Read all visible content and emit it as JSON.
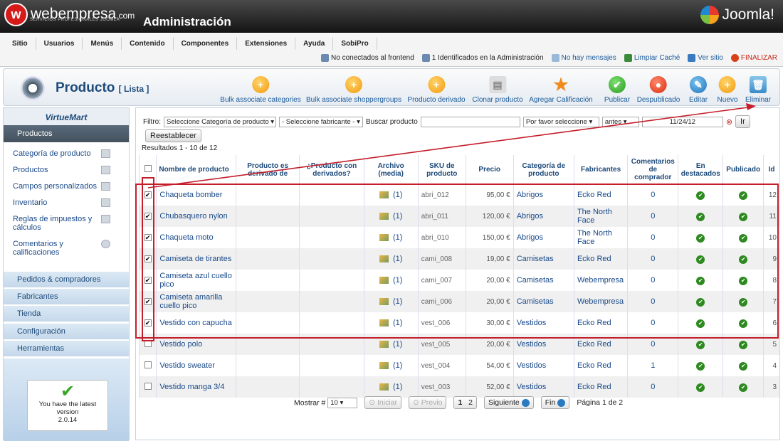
{
  "header": {
    "brand": "webempresa",
    "brand_suffix": ".com",
    "brand_tagline": "SERVICIOS PROFESIONALES JOOMLA",
    "title": "Administración",
    "joomla": "Joomla!"
  },
  "menu": [
    "Sitio",
    "Usuarios",
    "Menús",
    "Contenido",
    "Componentes",
    "Extensiones",
    "Ayuda",
    "SobiPro"
  ],
  "status": {
    "frontend": "No conectados al frontend",
    "admin": "1 Identificados en la Administración",
    "messages": "No hay mensajes",
    "cache": "Limpiar Caché",
    "site": "Ver sitio",
    "logout": "FINALIZAR"
  },
  "page": {
    "title": "Producto",
    "subtitle": "[ Lista ]"
  },
  "toolbar": [
    "Bulk associate categories",
    "Bulk associate shoppergroups",
    "Producto derivado",
    "Clonar producto",
    "Agregar Calificación",
    "Publicar",
    "Despublicado",
    "Editar",
    "Nuevo",
    "Eliminar"
  ],
  "sidebar": {
    "logo": "VirtueMart",
    "section": "Productos",
    "items": [
      "Categoría de producto",
      "Productos",
      "Campos personalizados",
      "Inventario",
      "Reglas de impuestos y cálculos",
      "Comentarios y calificaciones"
    ],
    "sections": [
      "Pedidos & compradores",
      "Fabricantes",
      "Tienda",
      "Configuración",
      "Herramientas"
    ],
    "latest": "You have the latest version",
    "version": "2.0.14"
  },
  "filter": {
    "label": "Filtro:",
    "category": "Seleccione Categoría de producto",
    "manufacturer": "- Seleccione fabricante -",
    "search_label": "Buscar producto",
    "order": "Por favor seleccione",
    "when": "antes",
    "date": "11/24/12",
    "go": "Ir",
    "reset": "Reestablecer",
    "results": "Resultados 1 - 10 de 12"
  },
  "columns": [
    "Nombre de producto",
    "Producto es derivado de",
    "¿Producto con derivados?",
    "Archivo (media)",
    "SKU de producto",
    "Precio",
    "Categoría de producto",
    "Fabricantes",
    "Comentarios de comprador",
    "En destacados",
    "Publicado",
    "Id"
  ],
  "rows": [
    {
      "name": "Chaqueta bomber",
      "media": "(1)",
      "sku": "abri_012",
      "price": "95,00 €",
      "category": "Abrigos",
      "maker": "Ecko Red",
      "reviews": "0",
      "id": "12",
      "checked": true
    },
    {
      "name": "Chubasquero nylon",
      "media": "(1)",
      "sku": "abri_011",
      "price": "120,00 €",
      "category": "Abrigos",
      "maker": "The North Face",
      "reviews": "0",
      "id": "11",
      "checked": true
    },
    {
      "name": "Chaqueta moto",
      "media": "(1)",
      "sku": "abri_010",
      "price": "150,00 €",
      "category": "Abrigos",
      "maker": "The North Face",
      "reviews": "0",
      "id": "10",
      "checked": true
    },
    {
      "name": "Camiseta de tirantes",
      "media": "(1)",
      "sku": "cami_008",
      "price": "19,00 €",
      "category": "Camisetas",
      "maker": "Ecko Red",
      "reviews": "0",
      "id": "9",
      "checked": true
    },
    {
      "name": "Camiseta azul cuello pico",
      "media": "(1)",
      "sku": "cami_007",
      "price": "20,00 €",
      "category": "Camisetas",
      "maker": "Webempresa",
      "reviews": "0",
      "id": "8",
      "checked": true
    },
    {
      "name": "Camiseta amarilla cuello pico",
      "media": "(1)",
      "sku": "cami_006",
      "price": "20,00 €",
      "category": "Camisetas",
      "maker": "Webempresa",
      "reviews": "0",
      "id": "7",
      "checked": true
    },
    {
      "name": "Vestido con capucha",
      "media": "(1)",
      "sku": "vest_006",
      "price": "30,00 €",
      "category": "Vestidos",
      "maker": "Ecko Red",
      "reviews": "0",
      "id": "6",
      "checked": true
    },
    {
      "name": "Vestido polo",
      "media": "(1)",
      "sku": "vest_005",
      "price": "20,00 €",
      "category": "Vestidos",
      "maker": "Ecko Red",
      "reviews": "0",
      "id": "5",
      "checked": false
    },
    {
      "name": "Vestido sweater",
      "media": "(1)",
      "sku": "vest_004",
      "price": "54,00 €",
      "category": "Vestidos",
      "maker": "Ecko Red",
      "reviews": "1",
      "id": "4",
      "checked": false
    },
    {
      "name": "Vestido manga 3/4",
      "media": "(1)",
      "sku": "vest_003",
      "price": "52,00 €",
      "category": "Vestidos",
      "maker": "Ecko Red",
      "reviews": "0",
      "id": "3",
      "checked": false
    }
  ],
  "pager": {
    "show": "Mostrar #",
    "limit": "10",
    "start": "Iniciar",
    "prev": "Previo",
    "p1": "1",
    "p2": "2",
    "next": "Siguiente",
    "end": "Fin",
    "info": "Página 1 de 2"
  }
}
